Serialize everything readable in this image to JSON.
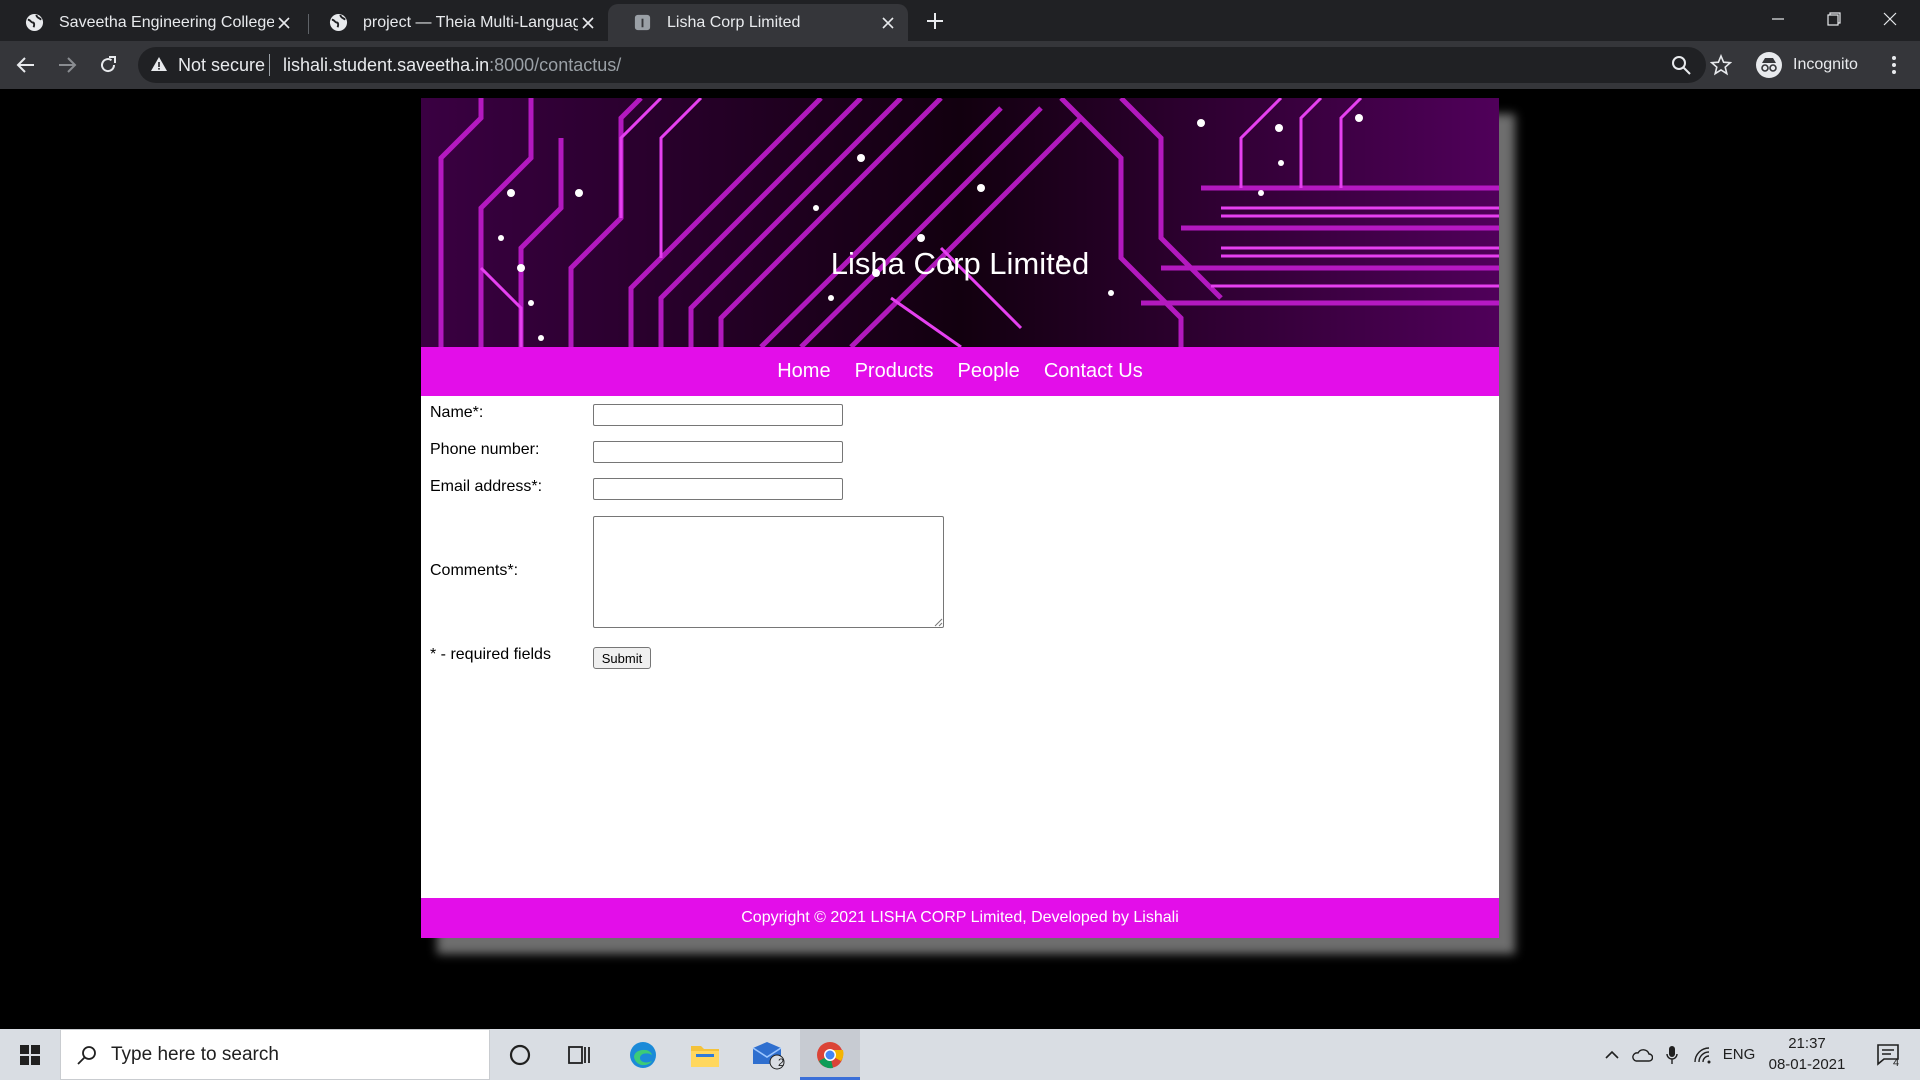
{
  "browser": {
    "tabs": [
      {
        "title": "Saveetha Engineering College"
      },
      {
        "title": "project — Theia Multi-Language"
      },
      {
        "title": "Lisha Corp Limited"
      }
    ],
    "security_label": "Not secure",
    "url_host": "lishali.student.saveetha.in",
    "url_rest": ":8000/contactus/",
    "profile_label": "Incognito"
  },
  "site": {
    "title": "Lisha Corp Limited",
    "nav": [
      "Home",
      "Products",
      "People",
      "Contact Us"
    ],
    "form": {
      "name_label": "Name*:",
      "phone_label": "Phone number:",
      "email_label": "Email address*:",
      "comments_label": "Comments*:",
      "required_note": "* - required fields",
      "submit_label": "Submit",
      "name_value": "",
      "phone_value": "",
      "email_value": "",
      "comments_value": ""
    },
    "footer": "Copyright © 2021 LISHA CORP Limited, Developed by Lishali",
    "accent_color": "#e30ee9"
  },
  "taskbar": {
    "search_placeholder": "Type here to search",
    "mail_badge": "2",
    "language": "ENG",
    "time": "21:37",
    "date": "08-01-2021",
    "notification_count": "4"
  }
}
